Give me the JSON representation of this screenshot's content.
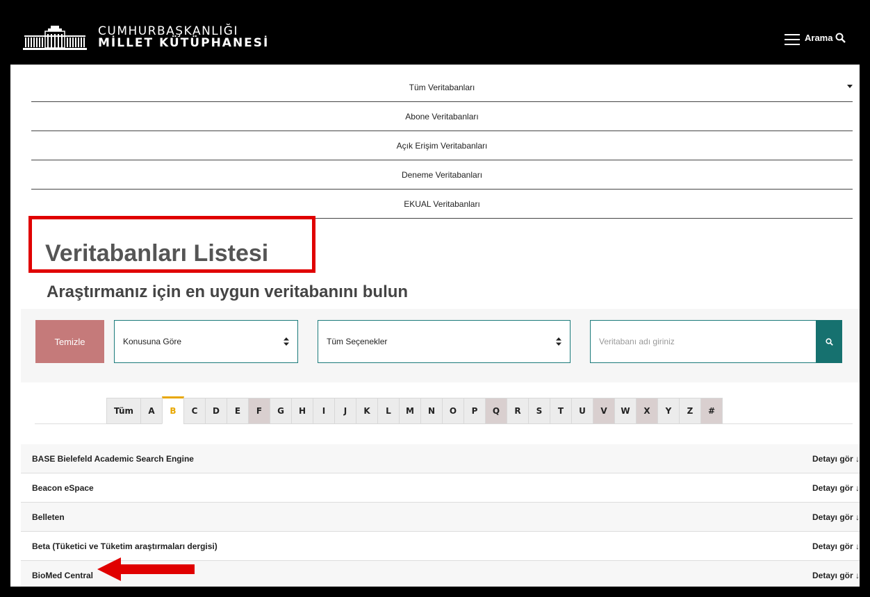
{
  "header": {
    "brand_top": "CUMHURBAŞKANLIĞI",
    "brand_bottom": "MİLLET KÜTÜPHANESİ",
    "search_label": "Arama",
    "menu_icon": "hamburger-icon",
    "search_icon": "search-icon"
  },
  "categories": [
    {
      "label": "Tüm Veritabanları"
    },
    {
      "label": "Abone Veritabanları"
    },
    {
      "label": "Açık Erişim Veritabanları"
    },
    {
      "label": "Deneme Veritabanları"
    },
    {
      "label": "EKUAL Veritabanları"
    }
  ],
  "page": {
    "title": "Veritabanları Listesi",
    "subtitle": "Araştırmanız için en uygun veritabanını bulun"
  },
  "filters": {
    "clear_label": "Temizle",
    "subject_select": "Konusuna Göre",
    "options_select": "Tüm Seçenekler",
    "search_placeholder": "Veritabanı adı giriniz"
  },
  "alphabet": {
    "tabs": [
      "Tüm",
      "A",
      "B",
      "C",
      "D",
      "E",
      "F",
      "G",
      "H",
      "I",
      "J",
      "K",
      "L",
      "M",
      "N",
      "O",
      "P",
      "Q",
      "R",
      "S",
      "T",
      "U",
      "V",
      "W",
      "X",
      "Y",
      "Z",
      "#"
    ],
    "active": "B",
    "disabled": [
      "F",
      "Q",
      "V",
      "X",
      "#"
    ]
  },
  "databases": [
    {
      "name": "BASE Bielefeld Academic Search Engine",
      "detail": "Detayı gör ↓"
    },
    {
      "name": "Beacon eSpace",
      "detail": "Detayı gör ↓"
    },
    {
      "name": "Belleten",
      "detail": "Detayı gör ↓"
    },
    {
      "name": "Beta (Tüketici ve Tüketim araştırmaları dergisi)",
      "detail": "Detayı gör ↓"
    },
    {
      "name": "BioMed Central",
      "detail": "Detayı gör ↓"
    }
  ],
  "colors": {
    "accent_teal": "#16716f",
    "clear_button": "#c57a7a",
    "highlight_red": "#e00000",
    "active_tab": "#e8a700"
  }
}
